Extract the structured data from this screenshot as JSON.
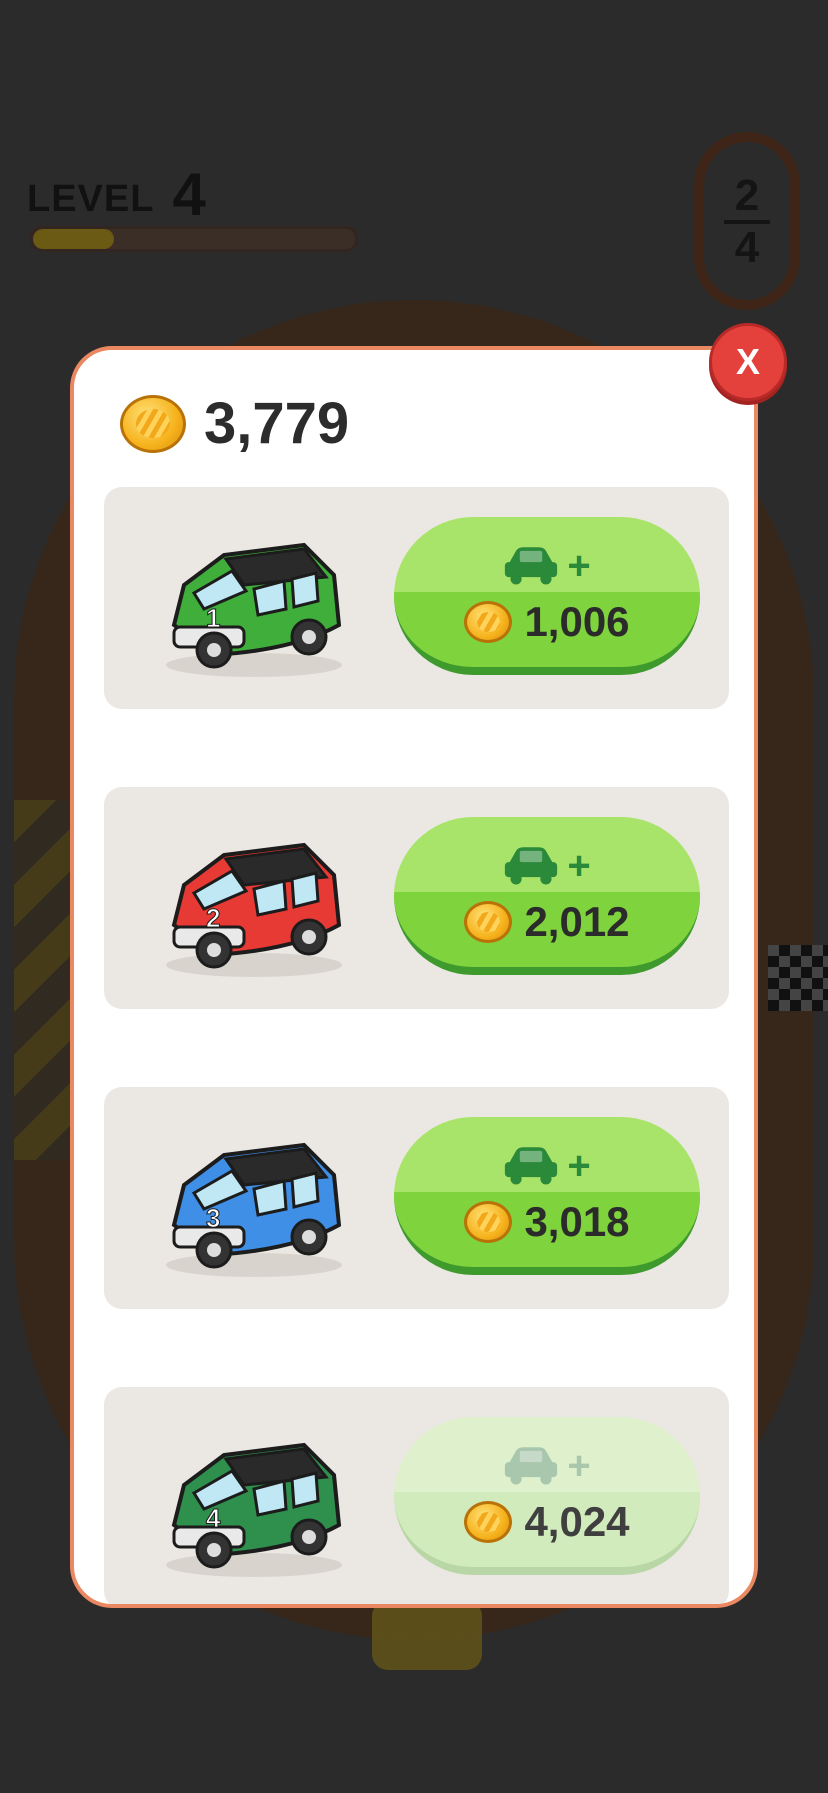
{
  "hud": {
    "level_label": "LEVEL",
    "level_number": "4",
    "level_progress": 0.25,
    "cars_current": "2",
    "cars_total": "4"
  },
  "shop": {
    "coin_balance": "3,779",
    "close_label": "X",
    "items": [
      {
        "car_number": "1",
        "color": "#3fae3b",
        "price": "1,006",
        "enabled": true
      },
      {
        "car_number": "2",
        "color": "#e73a35",
        "price": "2,012",
        "enabled": true
      },
      {
        "car_number": "3",
        "color": "#3f8fe6",
        "price": "3,018",
        "enabled": true
      },
      {
        "car_number": "4",
        "color": "#2f8f4c",
        "price": "4,024",
        "enabled": false
      }
    ]
  },
  "icons": {
    "coin": "coin-icon",
    "car": "car-icon",
    "plus": "+"
  }
}
